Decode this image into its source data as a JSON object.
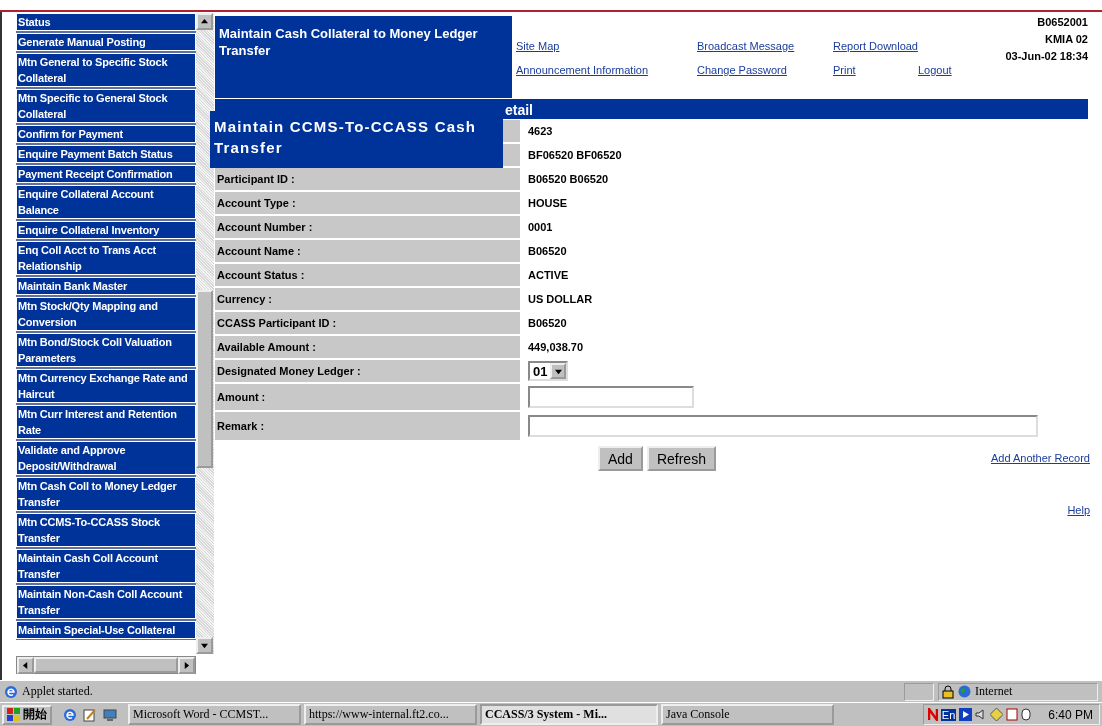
{
  "sidebar": {
    "items": [
      {
        "label": "Status"
      },
      {
        "label": "Generate Manual Posting"
      },
      {
        "label": "Mtn General to Specific Stock Collateral"
      },
      {
        "label": "Mtn Specific to General Stock Collateral"
      },
      {
        "label": "Confirm for Payment"
      },
      {
        "label": "Enquire Payment Batch Status"
      },
      {
        "label": "Payment Receipt Confirmation"
      },
      {
        "label": "Enquire Collateral Account Balance"
      },
      {
        "label": "Enquire Collateral Inventory"
      },
      {
        "label": "Enq Coll Acct to Trans Acct Relationship"
      },
      {
        "label": "Maintain Bank Master"
      },
      {
        "label": "Mtn Stock/Qty Mapping and Conversion"
      },
      {
        "label": "Mtn Bond/Stock Coll Valuation Parameters"
      },
      {
        "label": "Mtn Currency Exchange Rate and Haircut"
      },
      {
        "label": "Mtn Curr Interest and Retention Rate"
      },
      {
        "label": "Validate and Approve Deposit/Withdrawal"
      },
      {
        "label": "Mtn Cash Coll to Money Ledger Transfer"
      },
      {
        "label": "Mtn CCMS-To-CCASS Stock Transfer"
      },
      {
        "label": "Maintain Cash Coll Account Transfer"
      },
      {
        "label": "Maintain Non-Cash Coll Account Transfer"
      },
      {
        "label": "Maintain Special-Use Collateral"
      }
    ]
  },
  "page_title": "Maintain Cash Collateral to Money Ledger Transfer",
  "links": [
    [
      "Site Map",
      "Broadcast Message",
      "Report Download"
    ],
    [
      "Announcement Information",
      "Change Password",
      "Print",
      "Logout"
    ]
  ],
  "user_info": [
    "B0652001",
    "KMIA 02",
    "03-Jun-02 18:34"
  ],
  "section_header": "etail",
  "popup_title": "Maintain CCMS-To-CCASS Cash Transfer",
  "rows": [
    {
      "kind": "text",
      "value": "4623"
    },
    {
      "kind": "text",
      "value": "BF06520 BF06520"
    },
    {
      "kind": "text",
      "label": "Participant ID :",
      "value": "B06520 B06520"
    },
    {
      "kind": "text",
      "label": "Account Type :",
      "value": "HOUSE"
    },
    {
      "kind": "text",
      "label": "Account Number :",
      "value": "0001"
    },
    {
      "kind": "text",
      "label": "Account Name :",
      "value": "B06520"
    },
    {
      "kind": "text",
      "label": "Account Status :",
      "value": "ACTIVE"
    },
    {
      "kind": "text",
      "label": "Currency :",
      "value": "US DOLLAR"
    },
    {
      "kind": "text",
      "label": "CCASS Participant ID :",
      "value": "B06520"
    },
    {
      "kind": "text",
      "label": "Available Amount :",
      "value": "449,038.70"
    },
    {
      "kind": "select",
      "label": "Designated Money Ledger :",
      "value": "01"
    },
    {
      "kind": "input",
      "label": "Amount :"
    },
    {
      "kind": "wide_input",
      "label": "Remark :"
    }
  ],
  "buttons": [
    "Add",
    "Refresh"
  ],
  "add_another_link": "Add Another Record",
  "help_link": "Help",
  "status_bar": {
    "message": "Applet started.",
    "zone": "Internet"
  },
  "taskbar": {
    "start": "開始",
    "tasks": [
      {
        "label": "Microsoft Word - CCMST...",
        "selected": false
      },
      {
        "label": "https://www-internal.ft2.co...",
        "selected": false
      },
      {
        "label": "CCASS/3 System - Mi...",
        "selected": true
      },
      {
        "label": "Java Console",
        "selected": false
      }
    ],
    "language": "En",
    "clock": "6:40 PM"
  }
}
